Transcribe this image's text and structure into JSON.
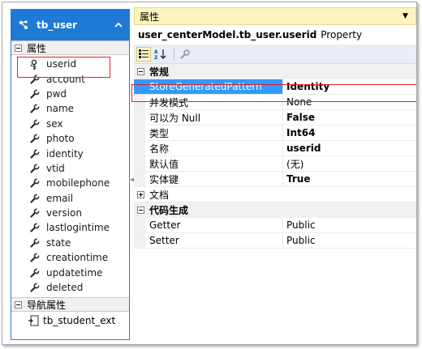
{
  "entity": {
    "title": "tb_user",
    "properties_section": "属性",
    "properties": [
      {
        "label": "userid",
        "icon": "key-icon"
      },
      {
        "label": "account",
        "icon": "wrench-icon"
      },
      {
        "label": "pwd",
        "icon": "wrench-icon"
      },
      {
        "label": "name",
        "icon": "wrench-icon"
      },
      {
        "label": "sex",
        "icon": "wrench-icon"
      },
      {
        "label": "photo",
        "icon": "wrench-icon"
      },
      {
        "label": "identity",
        "icon": "wrench-icon"
      },
      {
        "label": "vtid",
        "icon": "wrench-icon"
      },
      {
        "label": "mobilephone",
        "icon": "wrench-icon"
      },
      {
        "label": "email",
        "icon": "wrench-icon"
      },
      {
        "label": "version",
        "icon": "wrench-icon"
      },
      {
        "label": "lastlogintime",
        "icon": "wrench-icon"
      },
      {
        "label": "state",
        "icon": "wrench-icon"
      },
      {
        "label": "creationtime",
        "icon": "wrench-icon"
      },
      {
        "label": "updatetime",
        "icon": "wrench-icon"
      },
      {
        "label": "deleted",
        "icon": "wrench-icon"
      }
    ],
    "nav_section": "导航属性",
    "nav_items": [
      {
        "label": "tb_student_ext",
        "icon": "navigation-property-icon"
      }
    ]
  },
  "props_panel": {
    "title": "属性",
    "object_name": "user_centerModel.tb_user.userid",
    "object_type": "Property",
    "categories": [
      {
        "name": "常规",
        "rows": [
          {
            "name": "StoreGeneratedPattern",
            "value": "Identity",
            "bold": true,
            "selected": true
          },
          {
            "name": "并发模式",
            "value": "None",
            "bold": false
          },
          {
            "name": "可以为 Null",
            "value": "False",
            "bold": true
          },
          {
            "name": "类型",
            "value": "Int64",
            "bold": true
          },
          {
            "name": "名称",
            "value": "userid",
            "bold": true
          },
          {
            "name": "默认值",
            "value": "(无)",
            "bold": false
          },
          {
            "name": "实体键",
            "value": "True",
            "bold": true
          }
        ],
        "collapsed_child": "文档"
      },
      {
        "name": "代码生成",
        "rows": [
          {
            "name": "Getter",
            "value": "Public",
            "bold": false
          },
          {
            "name": "Setter",
            "value": "Public",
            "bold": false
          }
        ]
      }
    ]
  },
  "colors": {
    "entity_header": "#1e7ad6",
    "selection": "#3399ff",
    "title_bar": "#fdf4bf",
    "highlight_box": "#e0202a"
  }
}
